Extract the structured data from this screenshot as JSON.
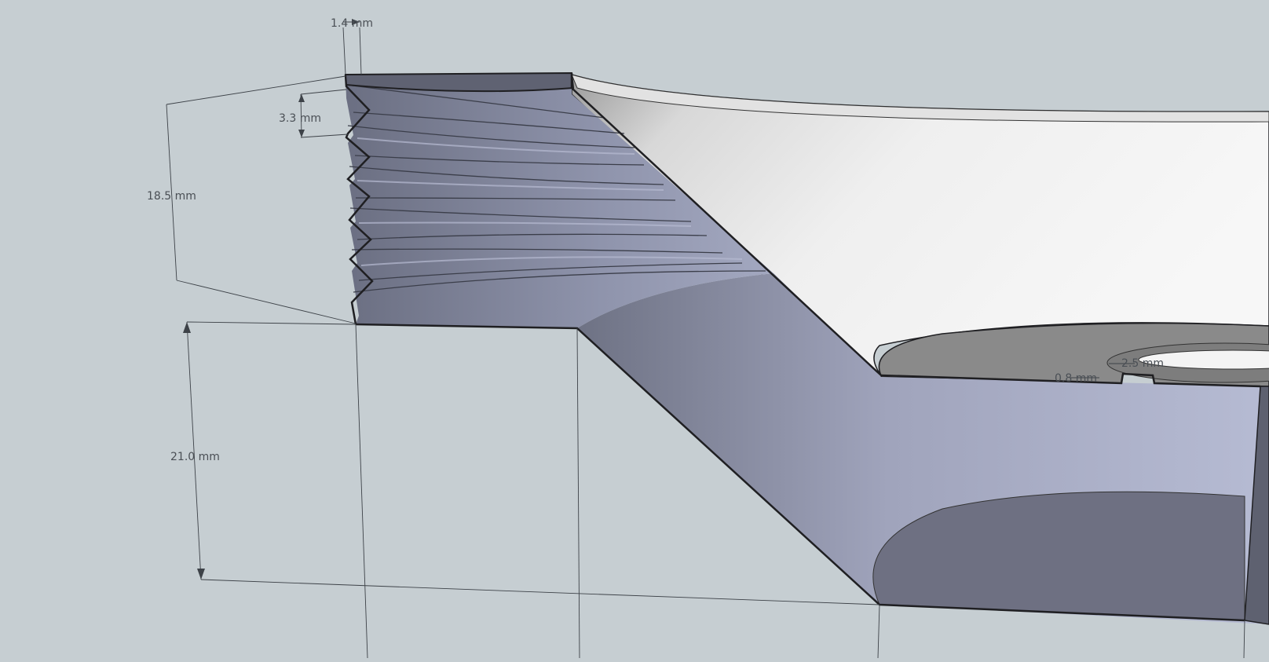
{
  "background_color": "#c6ced2",
  "model": {
    "thread_color": "#7a7f94",
    "body_color": "#9aa0b8",
    "bowl_color": "#f0f0f0",
    "edge_color": "#1f1f22"
  },
  "dimensions": {
    "pitch_depth": "1.4 mm",
    "thread_pitch": "3.3 mm",
    "thread_height": "18.5 mm",
    "neck_height": "21.0 mm",
    "slot_width": "2.5 mm",
    "slot_depth": "0.8 mm"
  }
}
